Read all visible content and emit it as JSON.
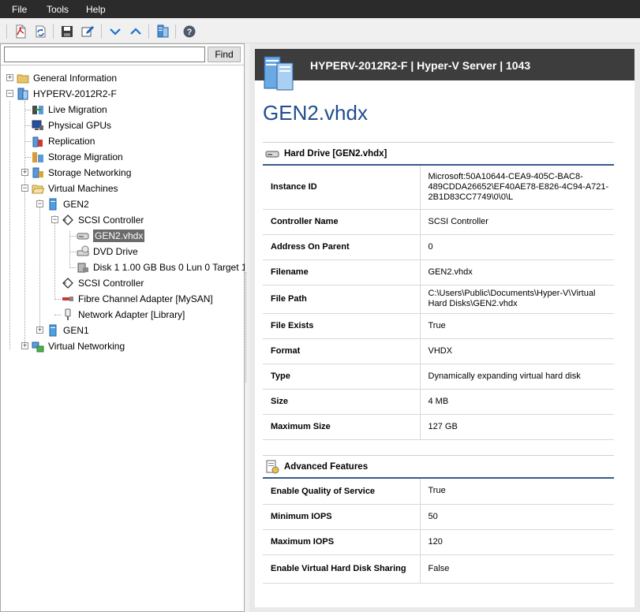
{
  "menu": {
    "file": "File",
    "tools": "Tools",
    "help": "Help"
  },
  "toolbar": {
    "buttons": [
      "pdf-export-icon",
      "refresh-icon",
      "save-icon",
      "edit-icon",
      "expand-down-icon",
      "collapse-up-icon",
      "server-settings-icon",
      "help-icon"
    ]
  },
  "search": {
    "value": "",
    "placeholder": "",
    "find_label": "Find"
  },
  "tree": {
    "general_information": "General Information",
    "host": "HYPERV-2012R2-F",
    "live_migration": "Live Migration",
    "physical_gpus": "Physical GPUs",
    "replication": "Replication",
    "storage_migration": "Storage Migration",
    "storage_networking": "Storage Networking",
    "virtual_machines": "Virtual Machines",
    "gen2": "GEN2",
    "scsi_controller_1": "SCSI Controller",
    "gen2_vhdx": "GEN2.vhdx",
    "dvd_drive": "DVD Drive",
    "disk1": "Disk 1 1.00 GB Bus 0 Lun 0 Target 1",
    "scsi_controller_2": "SCSI Controller",
    "fibre_channel": "Fibre Channel Adapter [MySAN]",
    "network_adapter": "Network Adapter [Library]",
    "gen1": "GEN1",
    "virtual_networking": "Virtual Networking"
  },
  "detail": {
    "header": "HYPERV-2012R2-F | Hyper-V Server | 1043",
    "title": "GEN2.vhdx",
    "hard_drive": {
      "heading": "Hard Drive [GEN2.vhdx]",
      "rows": [
        {
          "key": "Instance ID",
          "value": "Microsoft:50A10644-CEA9-405C-BAC8-489CDDA26652\\EF40AE78-E826-4C94-A721-2B1D83CC7749\\0\\0\\L"
        },
        {
          "key": "Controller Name",
          "value": "SCSI Controller"
        },
        {
          "key": "Address On Parent",
          "value": "0"
        },
        {
          "key": "Filename",
          "value": "GEN2.vhdx"
        },
        {
          "key": "File Path",
          "value": "C:\\Users\\Public\\Documents\\Hyper-V\\Virtual Hard Disks\\GEN2.vhdx"
        },
        {
          "key": "File Exists",
          "value": "True"
        },
        {
          "key": "Format",
          "value": "VHDX"
        },
        {
          "key": "Type",
          "value": "Dynamically expanding virtual hard disk"
        },
        {
          "key": "Size",
          "value": "4 MB"
        },
        {
          "key": "Maximum Size",
          "value": "127 GB"
        }
      ]
    },
    "advanced": {
      "heading": "Advanced Features",
      "rows": [
        {
          "key": "Enable Quality of Service",
          "value": "True"
        },
        {
          "key": "Minimum IOPS",
          "value": "50"
        },
        {
          "key": "Maximum IOPS",
          "value": "120"
        },
        {
          "key": "Enable Virtual Hard Disk Sharing",
          "value": "False"
        }
      ]
    }
  }
}
